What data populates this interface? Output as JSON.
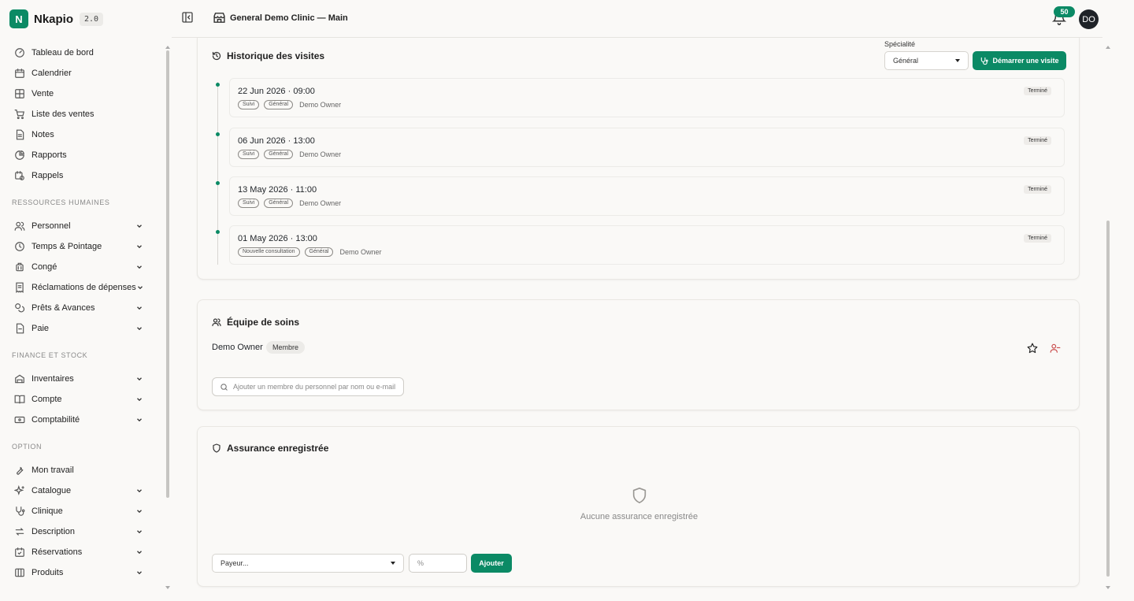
{
  "app": {
    "logo_letter": "N",
    "name": "Nkapio",
    "version": "2.0"
  },
  "sidebar": {
    "main": [
      {
        "label": "Tableau de bord",
        "icon": "gauge-icon"
      },
      {
        "label": "Calendrier",
        "icon": "calendar-icon"
      },
      {
        "label": "Vente",
        "icon": "grid-icon"
      },
      {
        "label": "Liste des ventes",
        "icon": "cart-icon"
      },
      {
        "label": "Notes",
        "icon": "note-icon"
      },
      {
        "label": "Rapports",
        "icon": "pie-chart-icon"
      },
      {
        "label": "Rappels",
        "icon": "calendar-clock-icon"
      }
    ],
    "sections": [
      {
        "title": "RESSOURCES HUMAINES",
        "items": [
          {
            "label": "Personnel",
            "icon": "users-icon"
          },
          {
            "label": "Temps & Pointage",
            "icon": "clock-icon"
          },
          {
            "label": "Congé",
            "icon": "luggage-icon"
          },
          {
            "label": "Réclamations de dépenses",
            "icon": "receipt-icon"
          },
          {
            "label": "Prêts & Avances",
            "icon": "coins-icon"
          },
          {
            "label": "Paie",
            "icon": "wallet-icon"
          }
        ]
      },
      {
        "title": "FINANCE ET STOCK",
        "items": [
          {
            "label": "Inventaires",
            "icon": "inventory-icon"
          },
          {
            "label": "Compte",
            "icon": "book-icon"
          },
          {
            "label": "Comptabilité",
            "icon": "banknote-icon"
          }
        ]
      },
      {
        "title": "OPTION",
        "items": [
          {
            "label": "Mon travail",
            "icon": "wrench-icon"
          },
          {
            "label": "Catalogue",
            "icon": "sparkles-icon"
          },
          {
            "label": "Clinique",
            "icon": "stethoscope-icon"
          },
          {
            "label": "Description",
            "icon": "arrows-icon"
          },
          {
            "label": "Réservations",
            "icon": "calendar-check-icon"
          },
          {
            "label": "Produits",
            "icon": "box-icon"
          }
        ]
      }
    ]
  },
  "header": {
    "clinic": "General Demo Clinic — Main",
    "notifications": "50",
    "avatar_initials": "DO"
  },
  "visits": {
    "title": "Historique des visites",
    "specialty_label": "Spécialité",
    "specialty_value": "Général",
    "start_button": "Démarrer une visite",
    "items": [
      {
        "date": "22 Jun 2026 · 09:00",
        "type": "Suivi",
        "specialty": "Général",
        "owner": "Demo Owner",
        "status": "Terminé"
      },
      {
        "date": "06 Jun 2026 · 13:00",
        "type": "Suivi",
        "specialty": "Général",
        "owner": "Demo Owner",
        "status": "Terminé"
      },
      {
        "date": "13 May 2026 · 11:00",
        "type": "Suivi",
        "specialty": "Général",
        "owner": "Demo Owner",
        "status": "Terminé"
      },
      {
        "date": "01 May 2026 · 13:00",
        "type": "Nouvelle consultation",
        "specialty": "Général",
        "owner": "Demo Owner",
        "status": "Terminé"
      }
    ]
  },
  "care_team": {
    "title": "Équipe de soins",
    "member": {
      "name": "Demo Owner",
      "role": "Membre"
    },
    "search_placeholder": "Ajouter un membre du personnel par nom ou e-mail"
  },
  "insurance": {
    "title": "Assurance enregistrée",
    "empty": "Aucune assurance enregistrée",
    "payer_placeholder": "Payeur...",
    "percent_placeholder": "%",
    "add_button": "Ajouter"
  },
  "colors": {
    "accent": "#0b8a65",
    "danger": "#c94a4a"
  }
}
